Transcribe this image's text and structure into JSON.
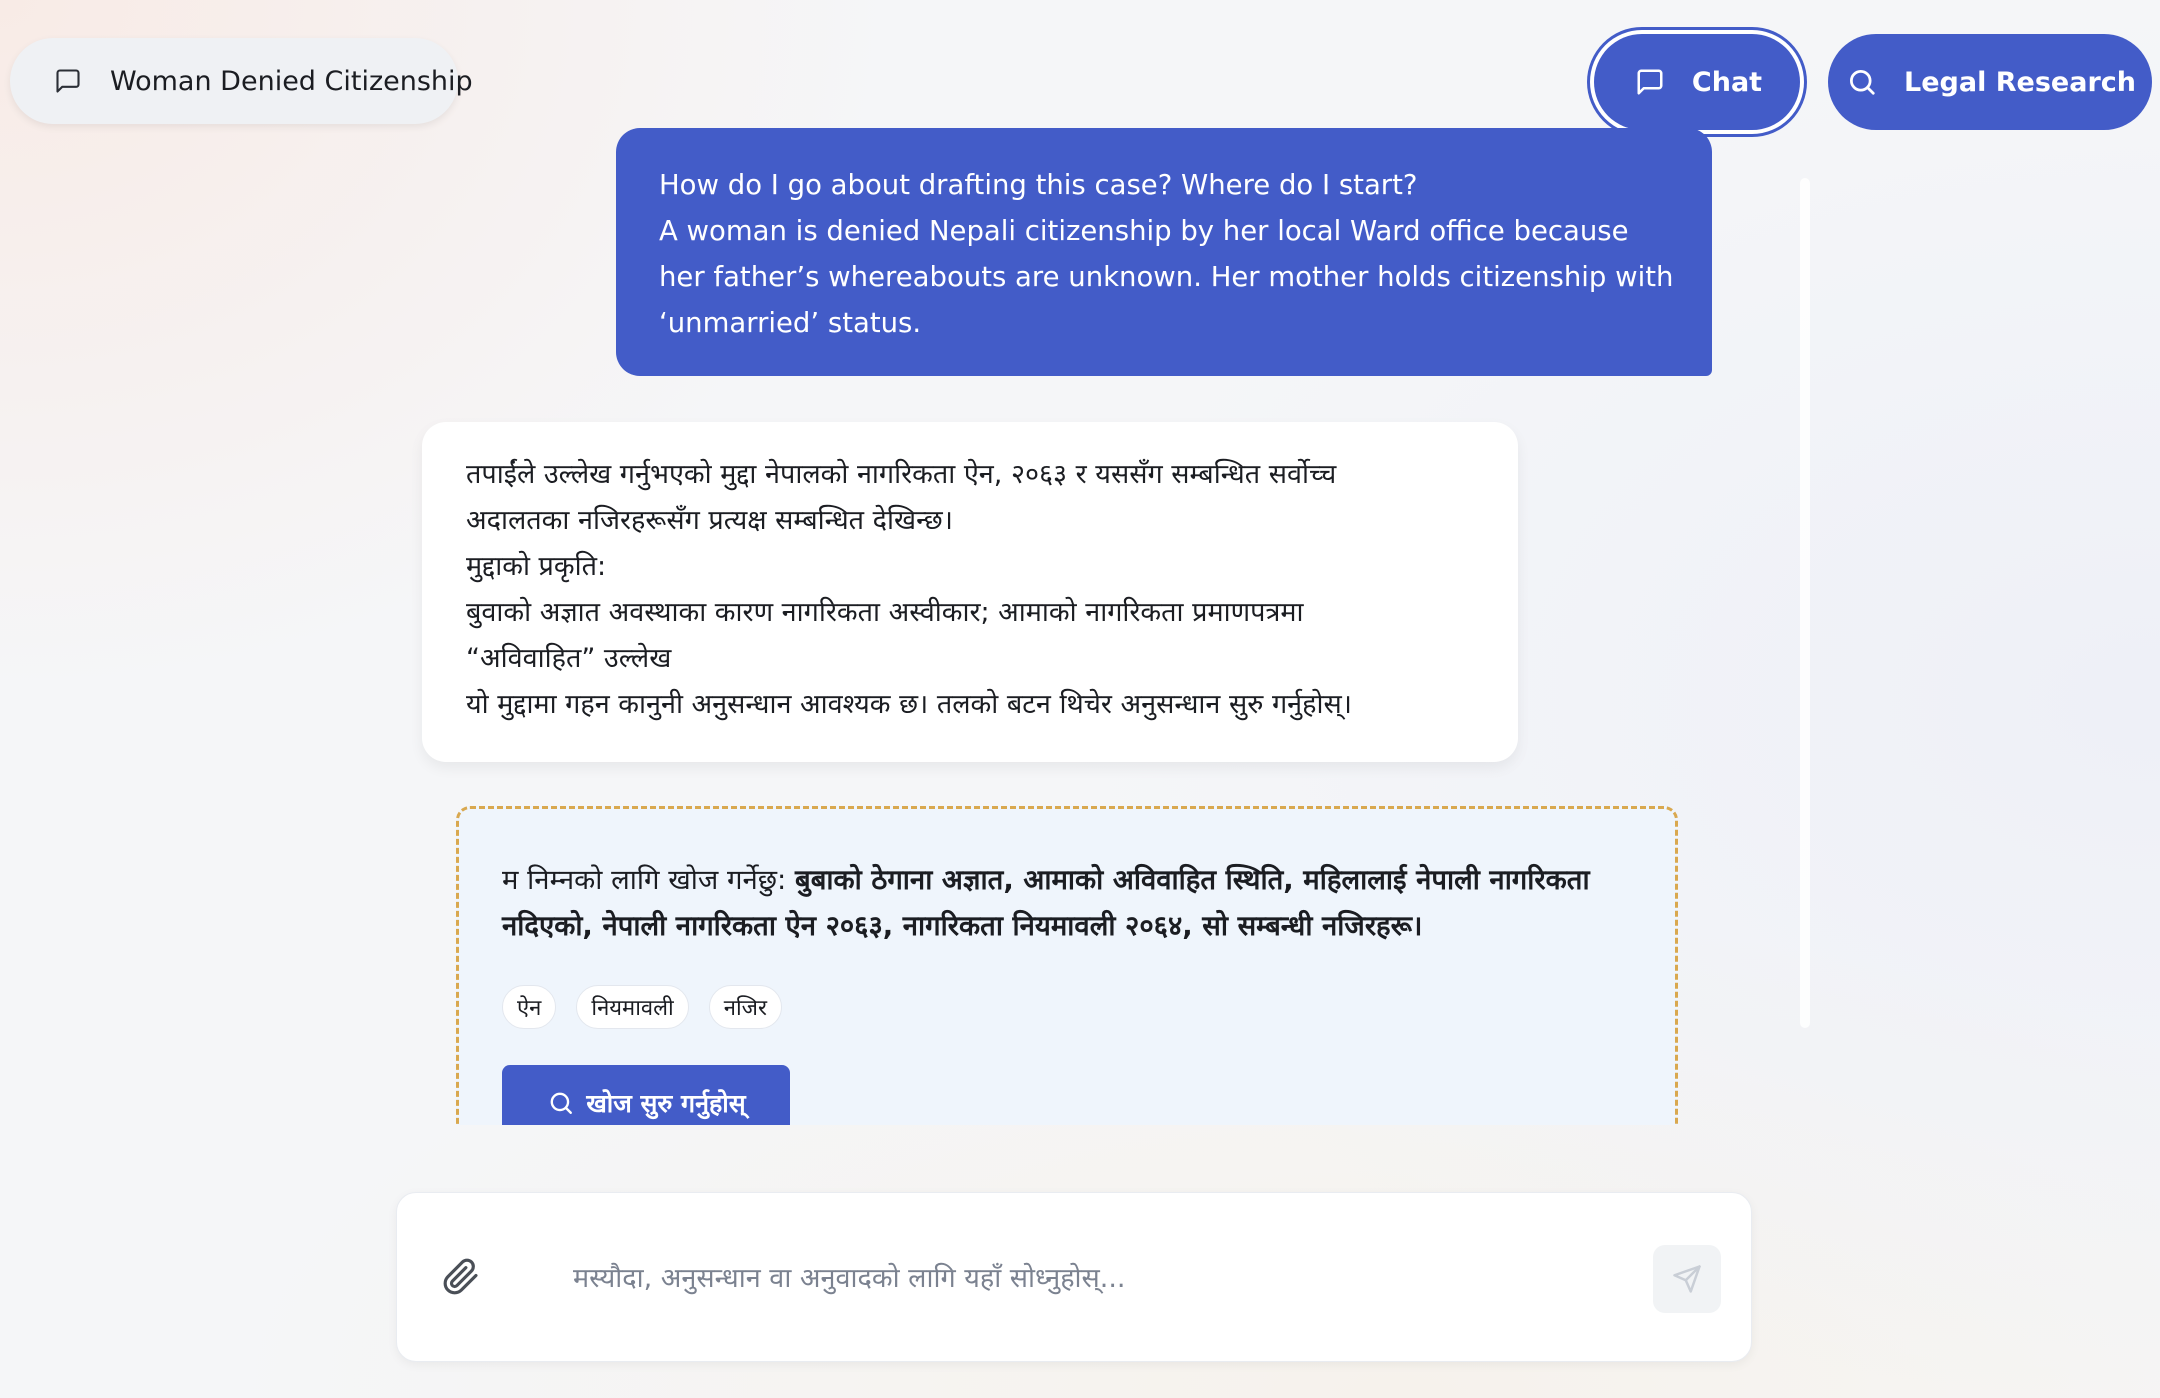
{
  "header": {
    "case_title": "Woman Denied Citizenship",
    "chat_label": "Chat",
    "research_label": "Legal Research"
  },
  "conversation": {
    "user_message": {
      "lines": [
        "How do I go about drafting this case? Where do I start?",
        "A woman is denied Nepali citizenship by her local Ward office because",
        "her father’s whereabouts are unknown. Her mother holds citizenship with",
        "‘unmarried’ status."
      ]
    },
    "assistant_message": {
      "lines": [
        "तपाईंले उल्लेख गर्नुभएको मुद्दा नेपालको नागरिकता ऐन, २०६३ र यससँग सम्बन्धित सर्वोच्च",
        "अदालतका नजिरहरूसँग प्रत्यक्ष सम्बन्धित देखिन्छ।",
        "मुद्दाको प्रकृति:",
        "बुवाको अज्ञात अवस्थाका कारण नागरिकता अस्वीकार; आमाको नागरिकता प्रमाणपत्रमा",
        "“अविवाहित” उल्लेख",
        "यो मुद्दामा गहन कानुनी अनुसन्धान आवश्यक छ। तलको बटन थिचेर अनुसन्धान सुरु गर्नुहोस्।"
      ]
    },
    "research_card": {
      "prefix": "म निम्नको लागि खोज गर्नेछु: ",
      "bold_line1": "बुबाको ठेगाना अज्ञात, आमाको अविवाहित स्थिति, महिलालाई नेपाली नागरिकता",
      "bold_line2": "नदिएको, नेपाली नागरिकता ऐन २०६३, नागरिकता नियमावली २०६४, सो सम्बन्धी नजिरहरू।",
      "tags": [
        "ऐन",
        "नियमावली",
        "नजिर"
      ],
      "button_label": "खोज सुरु गर्नुहोस्"
    }
  },
  "composer": {
    "placeholder": "मस्यौदा, अनुसन्धान वा अनुवादको लागि यहाँ सोध्नुहोस्...",
    "value": ""
  },
  "icons": {
    "case_chip": "message-square-icon",
    "chat": "message-square-icon",
    "research": "search-icon",
    "search_button": "search-icon",
    "attach": "paperclip-icon",
    "send": "send-icon"
  },
  "colors": {
    "accent": "#435cc8",
    "research_card_border": "#d9a84f",
    "research_card_bg": "#eff5fc"
  }
}
